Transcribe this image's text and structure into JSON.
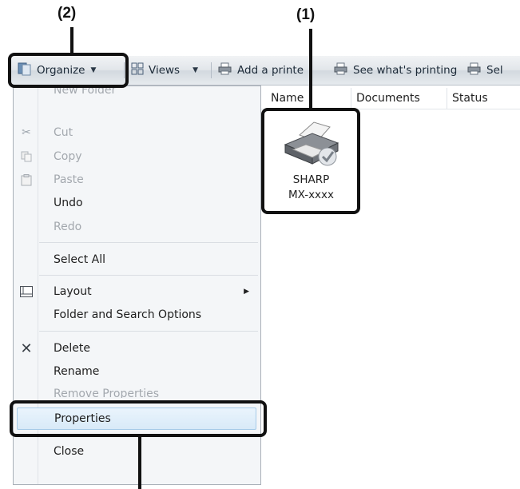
{
  "callouts": {
    "printer_label": "(1)",
    "organize_label": "(2)"
  },
  "toolbar": {
    "organize": "Organize",
    "views": "Views",
    "add_printer": "Add a printe",
    "see_printing": "See what's printing",
    "select": "Sel"
  },
  "columns": [
    "Name",
    "Documents",
    "Status"
  ],
  "printer": {
    "name": "SHARP",
    "model": "MX-xxxx"
  },
  "menu": {
    "new_folder": "New Folder",
    "cut": "Cut",
    "copy": "Copy",
    "paste": "Paste",
    "undo": "Undo",
    "redo": "Redo",
    "select_all": "Select All",
    "layout": "Layout",
    "folder_options": "Folder and Search Options",
    "delete": "Delete",
    "rename": "Rename",
    "remove_properties": "Remove Properties",
    "properties": "Properties",
    "close": "Close"
  },
  "icons": [
    "organize-icon",
    "views-icon",
    "add-printer-icon",
    "see-printing-icon",
    "select-icon",
    "cut-icon",
    "copy-icon",
    "paste-icon",
    "layout-icon",
    "delete-icon",
    "printer-icon",
    "default-check-icon"
  ]
}
